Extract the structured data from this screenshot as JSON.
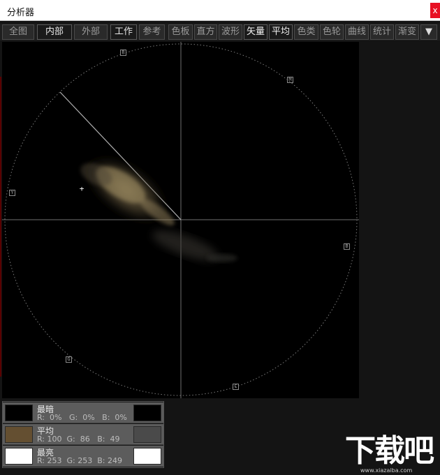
{
  "window": {
    "title": "分析器",
    "close_label": "x"
  },
  "toolbar": {
    "buttons": [
      {
        "label": "全图",
        "active": false
      },
      {
        "label": "内部",
        "active": true
      },
      {
        "label": "外部",
        "active": false
      },
      {
        "label": "工作",
        "active": true
      },
      {
        "label": "参考",
        "active": false
      },
      {
        "label": "色板",
        "active": false
      },
      {
        "label": "直方",
        "active": false
      },
      {
        "label": "波形",
        "active": false
      },
      {
        "label": "矢量",
        "active": true
      },
      {
        "label": "平均",
        "active": true
      },
      {
        "label": "色类",
        "active": false
      },
      {
        "label": "色轮",
        "active": false
      },
      {
        "label": "曲线",
        "active": false
      },
      {
        "label": "统计",
        "active": false
      },
      {
        "label": "渐变",
        "active": false
      }
    ],
    "menu_icon": "▼"
  },
  "vectorscope": {
    "markers": {
      "R": "R",
      "M": "M",
      "Y": "Y",
      "B": "B",
      "G": "G",
      "C": "C"
    },
    "cursor": "+"
  },
  "stats": {
    "darkest": {
      "label": "最暗",
      "r": "R:  0%",
      "g": "G:  0%",
      "b": "B:  0%",
      "color": "#000000"
    },
    "average": {
      "label": "平均",
      "r": "R: 100",
      "g": "G:  86",
      "b": "B:  49",
      "color": "#644f31"
    },
    "brightest": {
      "label": "最亮",
      "r": "R: 253",
      "g": "G: 253",
      "b": "B: 249",
      "color": "#ffffff"
    }
  },
  "watermark": {
    "text": "下载吧",
    "url": "www.xiazaiba.com"
  }
}
